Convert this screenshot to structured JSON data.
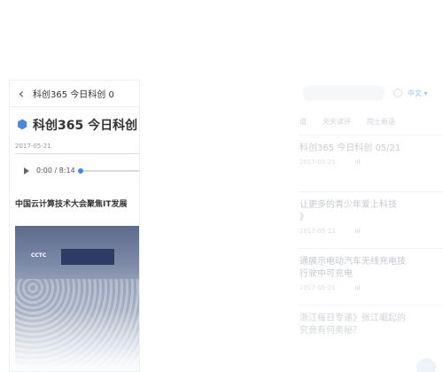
{
  "left": {
    "nav_title": "科创365 今日科创 0",
    "headline": "科创365 今日科创",
    "date": "2017-05-21",
    "player_time": "0:00 / 8:14",
    "progress": 0.0,
    "subheadline": "中国云计算技术大会聚焦IT发展",
    "photo_label": "CCTC",
    "colors": {
      "accent": "#4a86d9"
    }
  },
  "right": {
    "lang": "中文 ▾",
    "tabs": [
      "道",
      "天天读评",
      "院士新语"
    ],
    "items": [
      {
        "title": "科创365 今日科创 05/21",
        "date": "2017-05-21",
        "audio": "ııl"
      },
      {
        "title": "让更多的青少年爱上科技\n》",
        "date": "2017-05-21",
        "audio": "ııl"
      },
      {
        "title": "通展示电动汽车无线充电技\n行驶中可充电",
        "date": "2017-05-21",
        "audio": "ııl"
      },
      {
        "title": "浙江每日专递》张江崛起的\n究竟有何奥秘？",
        "date": "",
        "audio": ""
      }
    ]
  }
}
